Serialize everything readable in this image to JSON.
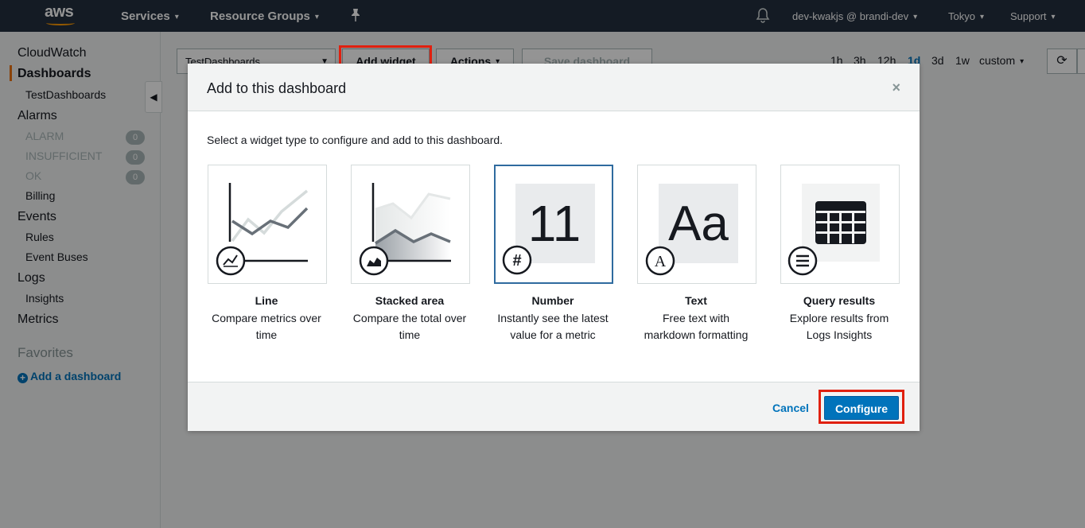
{
  "topnav": {
    "logo": "aws",
    "services": "Services",
    "resource_groups": "Resource Groups",
    "account": "dev-kwakjs @ brandi-dev",
    "region": "Tokyo",
    "support": "Support",
    "icons": [
      "pin-icon",
      "bell-icon"
    ]
  },
  "sidebar": {
    "cloudwatch": "CloudWatch",
    "dashboards": "Dashboards",
    "test_dashboards": "TestDashboards",
    "alarms": "Alarms",
    "alarm": "ALARM",
    "alarm_count": "0",
    "insufficient": "INSUFFICIENT",
    "insufficient_count": "0",
    "ok": "OK",
    "ok_count": "0",
    "billing": "Billing",
    "events": "Events",
    "rules": "Rules",
    "event_buses": "Event Buses",
    "logs": "Logs",
    "insights": "Insights",
    "metrics": "Metrics",
    "favorites": "Favorites",
    "add_dashboard": "Add a dashboard"
  },
  "toolbar": {
    "dashboard_select": "TestDashboards",
    "add_widget": "Add widget",
    "actions": "Actions",
    "save_dashboard": "Save dashboard",
    "ranges": [
      "1h",
      "3h",
      "12h",
      "1d",
      "3d",
      "1w"
    ],
    "active_range": "1d",
    "custom": "custom"
  },
  "modal": {
    "title": "Add to this dashboard",
    "close": "×",
    "description": "Select a widget type to configure and add to this dashboard.",
    "widgets": [
      {
        "name": "Line",
        "desc1": "Compare metrics over",
        "desc2": "time",
        "icon": "line-chart-icon"
      },
      {
        "name": "Stacked area",
        "desc1": "Compare the total over",
        "desc2": "time",
        "icon": "area-chart-icon"
      },
      {
        "name": "Number",
        "desc1": "Instantly see the latest",
        "desc2": "value for a metric",
        "icon": "hash-icon",
        "preview": "11",
        "selected": true
      },
      {
        "name": "Text",
        "desc1": "Free text with",
        "desc2": "markdown formatting",
        "icon": "text-icon",
        "preview": "Aa"
      },
      {
        "name": "Query results",
        "desc1": "Explore results from",
        "desc2": "Logs Insights",
        "icon": "list-icon"
      }
    ],
    "cancel": "Cancel",
    "configure": "Configure"
  },
  "colors": {
    "nav_bg": "#232f3e",
    "accent": "#ec7211",
    "link": "#0073bb",
    "highlight": "#e0200f"
  }
}
